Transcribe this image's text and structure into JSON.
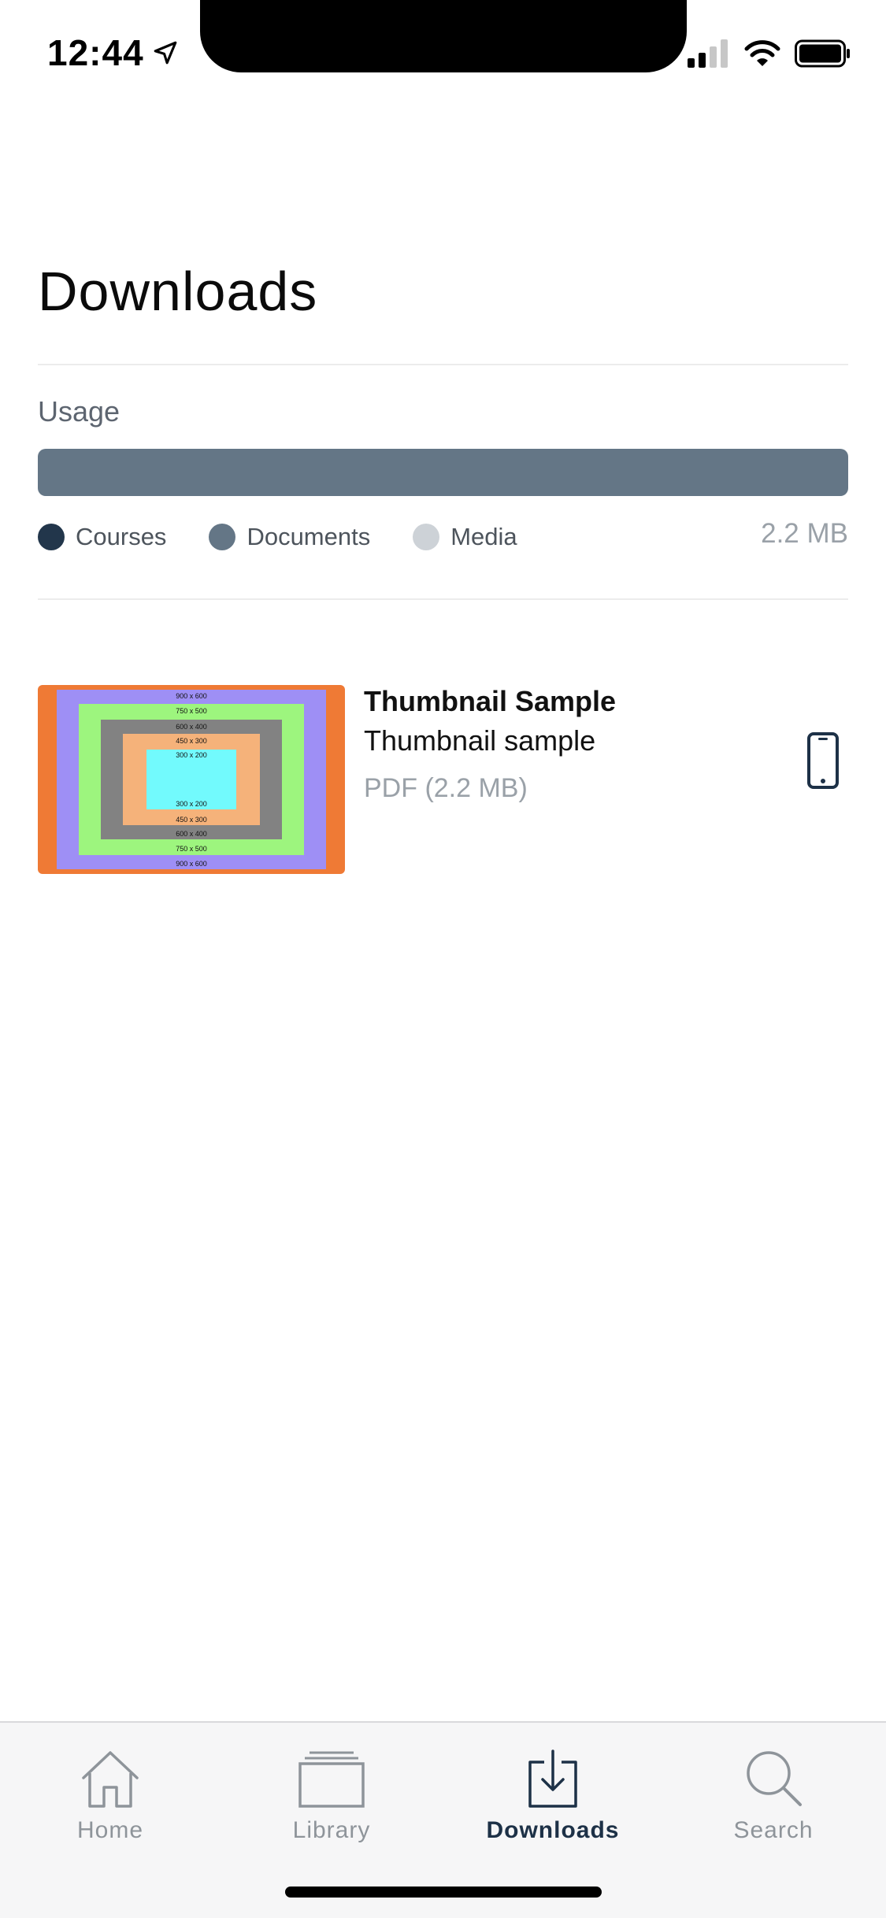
{
  "status_bar": {
    "time": "12:44"
  },
  "header": {
    "title": "Downloads"
  },
  "usage": {
    "label": "Usage",
    "fill_fraction": 1.0,
    "total": "2.2 MB",
    "legend": [
      {
        "label": "Courses",
        "color": "#22364b"
      },
      {
        "label": "Documents",
        "color": "#647686"
      },
      {
        "label": "Media",
        "color": "#cdd2d7"
      }
    ]
  },
  "downloads": [
    {
      "title": "Thumbnail Sample",
      "subtitle": "Thumbnail sample",
      "meta": "PDF (2.2 MB)",
      "thumbnail_labels": [
        "900 x 600",
        "750 x 500",
        "600 x 400",
        "450 x 300",
        "300 x 200"
      ]
    }
  ],
  "tabs": [
    {
      "label": "Home",
      "icon": "home-icon",
      "active": false
    },
    {
      "label": "Library",
      "icon": "library-icon",
      "active": false
    },
    {
      "label": "Downloads",
      "icon": "downloads-icon",
      "active": true
    },
    {
      "label": "Search",
      "icon": "search-icon",
      "active": false
    }
  ],
  "colors": {
    "accent": "#1d3147",
    "inactive_tab": "#8e949a"
  }
}
